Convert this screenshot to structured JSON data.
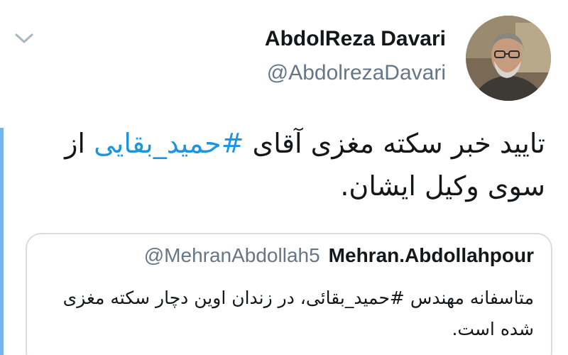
{
  "tweet": {
    "author_name": "AbdolReza Davari",
    "author_handle": "@AbdolrezaDavari",
    "text_before_hashtag": "تایید خبر سکته مغزی آقای ",
    "hashtag": "#حمید_بقایی",
    "text_after_hashtag": " از سوی وکیل ایشان."
  },
  "quoted_tweet": {
    "author_name": "Mehran.Abdollahpour",
    "author_handle": "@MehranAbdollah5",
    "text": "متاسفانه مهندس #حمید_بقائی، در زندان اوین دچار سکته مغزی شده است."
  },
  "icons": {
    "menu": "chevron-down-icon",
    "avatar": "profile-photo"
  },
  "colors": {
    "link": "#1b95e0",
    "secondary_text": "#657786",
    "border": "#d6dee4",
    "accent_bar": "#74b4e8"
  }
}
